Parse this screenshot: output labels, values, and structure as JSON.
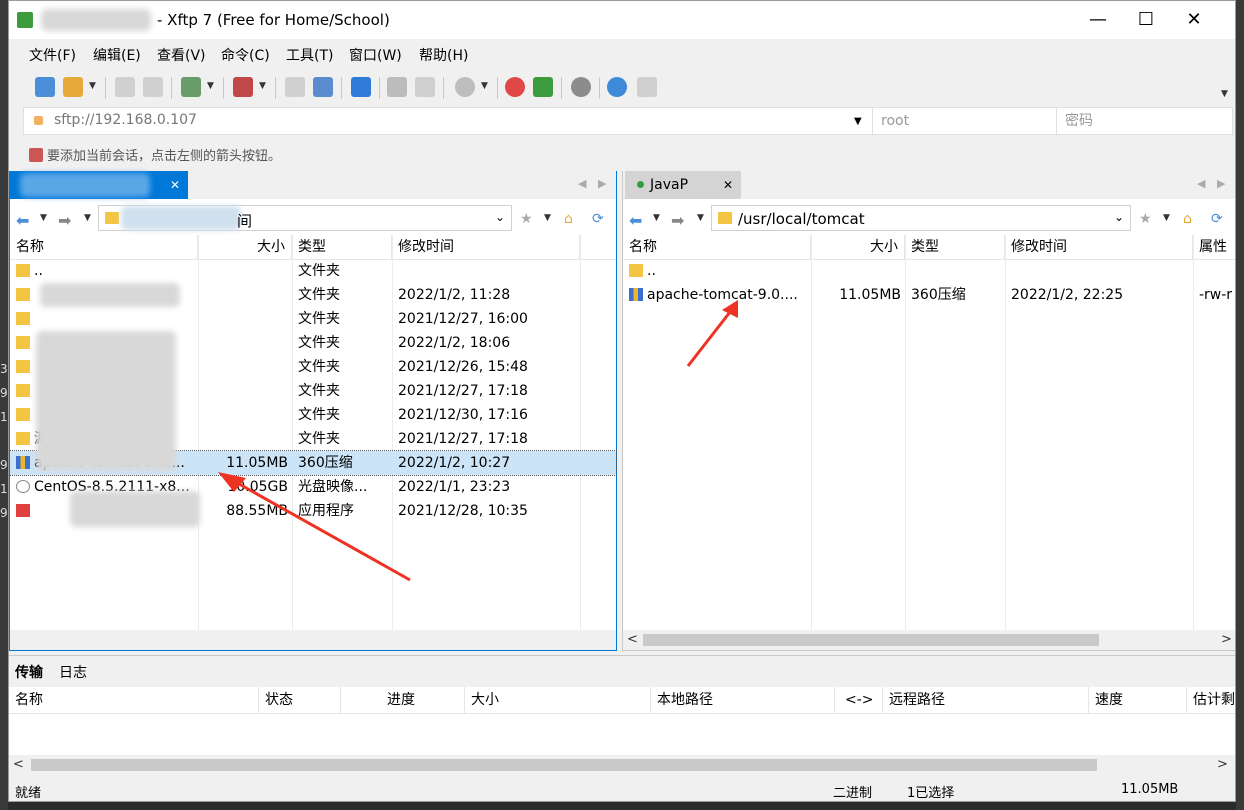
{
  "window": {
    "title": "- Xftp 7 (Free for Home/School)",
    "controls": {
      "minimize": "—",
      "maximize": "☐",
      "close": "✕"
    }
  },
  "menu": [
    "文件(F)",
    "编辑(E)",
    "查看(V)",
    "命令(C)",
    "工具(T)",
    "窗口(W)",
    "帮助(H)"
  ],
  "address": {
    "url": "sftp://192.168.0.107",
    "user": "root",
    "password_placeholder": "密码"
  },
  "hint": "要添加当前会话，点击左侧的箭头按钮。",
  "left_pane": {
    "path": "间",
    "columns": [
      "名称",
      "大小",
      "类型",
      "修改时间"
    ],
    "rows": [
      {
        "name": "..",
        "size": "",
        "type": "文件夹",
        "modified": "",
        "icon": "folder"
      },
      {
        "name": "",
        "size": "",
        "type": "文件夹",
        "modified": "2022/1/2, 11:28",
        "icon": "folder"
      },
      {
        "name": "",
        "size": "",
        "type": "文件夹",
        "modified": "2021/12/27, 16:00",
        "icon": "folder"
      },
      {
        "name": "",
        "size": "",
        "type": "文件夹",
        "modified": "2022/1/2, 18:06",
        "icon": "folder"
      },
      {
        "name": "",
        "size": "",
        "type": "文件夹",
        "modified": "2021/12/26, 15:48",
        "icon": "folder"
      },
      {
        "name": "",
        "size": "",
        "type": "文件夹",
        "modified": "2021/12/27, 17:18",
        "icon": "folder"
      },
      {
        "name": "",
        "size": "",
        "type": "文件夹",
        "modified": "2021/12/30, 17:16",
        "icon": "folder"
      },
      {
        "name": "源",
        "size": "",
        "type": "文件夹",
        "modified": "2021/12/27, 17:18",
        "icon": "folder"
      },
      {
        "name": "apache-tomcat-9.0....",
        "size": "11.05MB",
        "type": "360压缩",
        "modified": "2022/1/2, 10:27",
        "icon": "zip",
        "selected": true
      },
      {
        "name": "CentOS-8.5.2111-x8...",
        "size": "10.05GB",
        "type": "光盘映像...",
        "modified": "2022/1/1, 23:23",
        "icon": "iso"
      },
      {
        "name": "",
        "size": "88.55MB",
        "type": "应用程序",
        "modified": "2021/12/28, 10:35",
        "icon": "exe"
      }
    ]
  },
  "right_pane": {
    "tab": "JavaP",
    "path": "/usr/local/tomcat",
    "columns": [
      "名称",
      "大小",
      "类型",
      "修改时间",
      "属性"
    ],
    "rows": [
      {
        "name": "..",
        "size": "",
        "type": "",
        "modified": "",
        "attr": "",
        "icon": "folder"
      },
      {
        "name": "apache-tomcat-9.0....",
        "size": "11.05MB",
        "type": "360压缩",
        "modified": "2022/1/2, 22:25",
        "attr": "-rw-r",
        "icon": "zip"
      }
    ]
  },
  "bottom_tabs": [
    "传输",
    "日志"
  ],
  "transfer_columns": [
    "名称",
    "状态",
    "进度",
    "大小",
    "本地路径",
    "<->",
    "远程路径",
    "速度",
    "估计剩"
  ],
  "status": {
    "left": "就绪",
    "mode": "二进制",
    "selected": "1已选择",
    "size": "11.05MB"
  },
  "colors": {
    "selection": "#cce4f7",
    "accent": "#0078d7",
    "arrow": "#ee3322"
  }
}
